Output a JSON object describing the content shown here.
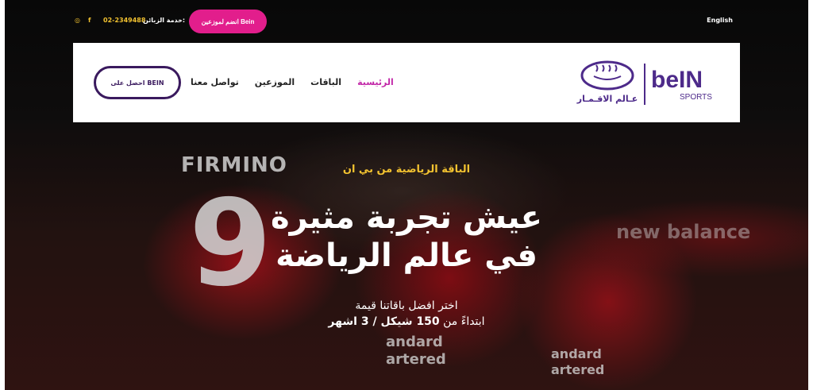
{
  "topbar": {
    "language_label": "English",
    "support_label": "خدمة الزبائن:",
    "phone": "02-2349488",
    "join_button": "انضم لموزعين Bein",
    "social": [
      {
        "icon": "facebook-icon",
        "glyph": "f"
      },
      {
        "icon": "instagram-icon",
        "glyph": "◎"
      }
    ]
  },
  "nav": {
    "cta_label": "احصل على BEIN",
    "items": [
      {
        "label": "تواصل معنا"
      },
      {
        "label": "الموزعين"
      },
      {
        "label": "الباقات"
      },
      {
        "label": "الرئيسية",
        "active": true
      }
    ]
  },
  "logo": {
    "brand": "beIN",
    "brand_sub": "SPORTS",
    "arabic_text": "عـالم الاقـمـار"
  },
  "hero": {
    "eyebrow": "الباقة الرياضية من بي ان",
    "headline_line1": "عيش تجربة مثيرة",
    "headline_line2": "في عالم الرياضة",
    "sub_line1": "اختر افضل باقاتنا قيمة",
    "sub_line2_prefix": "ابتداءً من",
    "sub_line2_bold": "150 شيكل / 3 اشهر"
  },
  "background": {
    "jersey_name": "FIRMINO",
    "jersey_number": "9",
    "sponsor_line1": "andard",
    "sponsor_line2": "artered",
    "sponsor2_line1": "andard",
    "sponsor2_line2": "artered",
    "stadium_banner": "new balance"
  },
  "colors": {
    "accent_pink": "#e21e8c",
    "accent_yellow": "#f2c230",
    "brand_purple": "#3a1a5e",
    "nav_active": "#c228a8"
  }
}
